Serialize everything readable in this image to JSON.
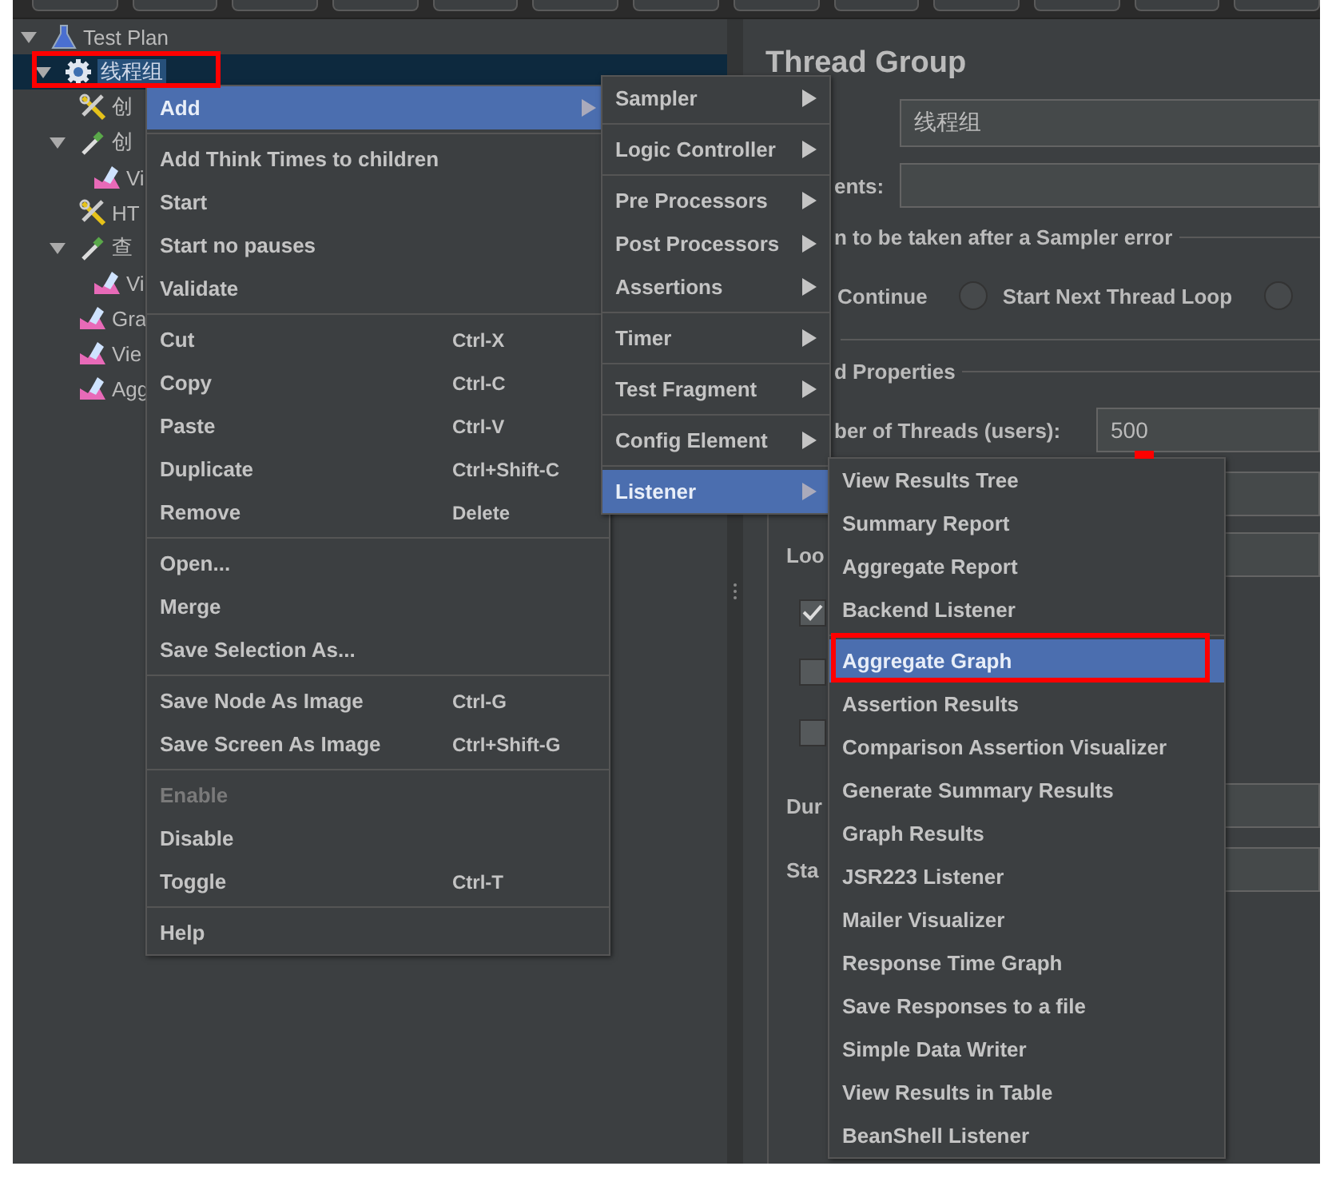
{
  "tree": {
    "items": [
      {
        "label": "Test Plan",
        "kind": "flask",
        "expanded": true,
        "selected": false,
        "children": [
          {
            "label": "线程组",
            "kind": "gear",
            "expanded": true,
            "selected": true,
            "children": [
              {
                "label": "创",
                "kind": "tools",
                "selected": false
              },
              {
                "label": "创",
                "kind": "dropper",
                "expanded": true,
                "selected": false,
                "children": [
                  {
                    "label": "Vi",
                    "kind": "chart",
                    "selected": false
                  }
                ]
              },
              {
                "label": "HT",
                "kind": "tools",
                "selected": false
              },
              {
                "label": "查",
                "kind": "dropper",
                "expanded": true,
                "selected": false,
                "children": [
                  {
                    "label": "Vi",
                    "kind": "chart",
                    "selected": false
                  }
                ]
              },
              {
                "label": "Gra",
                "kind": "chart",
                "selected": false
              },
              {
                "label": "Vie",
                "kind": "chart",
                "selected": false
              },
              {
                "label": "Agg",
                "kind": "chart",
                "selected": false
              }
            ]
          }
        ]
      }
    ]
  },
  "thread_group": {
    "title": "Thread Group",
    "name_value": "线程组",
    "comments_label": "ents:",
    "error_section": "n to be taken after a Sampler error",
    "error_actions": [
      {
        "kind": "label",
        "label": "Continue"
      },
      {
        "kind": "radio",
        "label": "Start Next Thread Loop",
        "selected": false
      },
      {
        "kind": "radio",
        "selected": false
      }
    ],
    "properties_section": "d Properties",
    "threads_label": "ber of Threads (users):",
    "threads_value": "500",
    "loop_label": "Loo",
    "checkboxes": [
      {
        "checked": true
      },
      {
        "checked": false
      },
      {
        "checked": false
      }
    ],
    "duration_label": "Dur",
    "startup_label": "Sta"
  },
  "context_menu": {
    "groups": [
      {
        "items": [
          {
            "label": "Add",
            "has_submenu": true,
            "selected": true,
            "disabled": false
          }
        ]
      },
      {
        "items": [
          {
            "label": "Add Think Times to children",
            "has_submenu": false,
            "selected": false,
            "disabled": false
          },
          {
            "label": "Start",
            "has_submenu": false,
            "selected": false,
            "disabled": false
          },
          {
            "label": "Start no pauses",
            "has_submenu": false,
            "selected": false,
            "disabled": false
          },
          {
            "label": "Validate",
            "has_submenu": false,
            "selected": false,
            "disabled": false
          }
        ]
      },
      {
        "items": [
          {
            "label": "Cut",
            "shortcut": "Ctrl-X",
            "has_submenu": false,
            "selected": false,
            "disabled": false
          },
          {
            "label": "Copy",
            "shortcut": "Ctrl-C",
            "has_submenu": false,
            "selected": false,
            "disabled": false
          },
          {
            "label": "Paste",
            "shortcut": "Ctrl-V",
            "has_submenu": false,
            "selected": false,
            "disabled": false
          },
          {
            "label": "Duplicate",
            "shortcut": "Ctrl+Shift-C",
            "has_submenu": false,
            "selected": false,
            "disabled": false
          },
          {
            "label": "Remove",
            "shortcut": "Delete",
            "has_submenu": false,
            "selected": false,
            "disabled": false
          }
        ]
      },
      {
        "items": [
          {
            "label": "Open...",
            "has_submenu": false,
            "selected": false,
            "disabled": false
          },
          {
            "label": "Merge",
            "has_submenu": false,
            "selected": false,
            "disabled": false
          },
          {
            "label": "Save Selection As...",
            "has_submenu": false,
            "selected": false,
            "disabled": false
          }
        ]
      },
      {
        "items": [
          {
            "label": "Save Node As Image",
            "shortcut": "Ctrl-G",
            "has_submenu": false,
            "selected": false,
            "disabled": false
          },
          {
            "label": "Save Screen As Image",
            "shortcut": "Ctrl+Shift-G",
            "has_submenu": false,
            "selected": false,
            "disabled": false
          }
        ]
      },
      {
        "items": [
          {
            "label": "Enable",
            "has_submenu": false,
            "selected": false,
            "disabled": true
          },
          {
            "label": "Disable",
            "has_submenu": false,
            "selected": false,
            "disabled": false
          },
          {
            "label": "Toggle",
            "shortcut": "Ctrl-T",
            "has_submenu": false,
            "selected": false,
            "disabled": false
          }
        ]
      },
      {
        "items": [
          {
            "label": "Help",
            "has_submenu": false,
            "selected": false,
            "disabled": false
          }
        ]
      }
    ]
  },
  "add_submenu": {
    "groups": [
      {
        "items": [
          {
            "label": "Sampler",
            "has_submenu": true,
            "selected": false,
            "disabled": false
          }
        ]
      },
      {
        "items": [
          {
            "label": "Logic Controller",
            "has_submenu": true,
            "selected": false,
            "disabled": false
          }
        ]
      },
      {
        "items": [
          {
            "label": "Pre Processors",
            "has_submenu": true,
            "selected": false,
            "disabled": false
          },
          {
            "label": "Post Processors",
            "has_submenu": true,
            "selected": false,
            "disabled": false
          },
          {
            "label": "Assertions",
            "has_submenu": true,
            "selected": false,
            "disabled": false
          }
        ]
      },
      {
        "items": [
          {
            "label": "Timer",
            "has_submenu": true,
            "selected": false,
            "disabled": false
          }
        ]
      },
      {
        "items": [
          {
            "label": "Test Fragment",
            "has_submenu": true,
            "selected": false,
            "disabled": false
          }
        ]
      },
      {
        "items": [
          {
            "label": "Config Element",
            "has_submenu": true,
            "selected": false,
            "disabled": false
          }
        ]
      },
      {
        "items": [
          {
            "label": "Listener",
            "has_submenu": true,
            "selected": true,
            "disabled": false
          }
        ]
      }
    ]
  },
  "listener_submenu": {
    "groups": [
      {
        "items": [
          {
            "label": "View Results Tree",
            "has_submenu": false,
            "selected": false,
            "disabled": false
          },
          {
            "label": "Summary Report",
            "has_submenu": false,
            "selected": false,
            "disabled": false
          },
          {
            "label": "Aggregate Report",
            "has_submenu": false,
            "selected": false,
            "disabled": false
          },
          {
            "label": "Backend Listener",
            "has_submenu": false,
            "selected": false,
            "disabled": false
          }
        ]
      },
      {
        "items": [
          {
            "label": "Aggregate Graph",
            "has_submenu": false,
            "selected": true,
            "disabled": false
          },
          {
            "label": "Assertion Results",
            "has_submenu": false,
            "selected": false,
            "disabled": false
          },
          {
            "label": "Comparison Assertion Visualizer",
            "has_submenu": false,
            "selected": false,
            "disabled": false
          },
          {
            "label": "Generate Summary Results",
            "has_submenu": false,
            "selected": false,
            "disabled": false
          },
          {
            "label": "Graph Results",
            "has_submenu": false,
            "selected": false,
            "disabled": false
          },
          {
            "label": "JSR223 Listener",
            "has_submenu": false,
            "selected": false,
            "disabled": false
          },
          {
            "label": "Mailer Visualizer",
            "has_submenu": false,
            "selected": false,
            "disabled": false
          },
          {
            "label": "Response Time Graph",
            "has_submenu": false,
            "selected": false,
            "disabled": false
          },
          {
            "label": "Save Responses to a file",
            "has_submenu": false,
            "selected": false,
            "disabled": false
          },
          {
            "label": "Simple Data Writer",
            "has_submenu": false,
            "selected": false,
            "disabled": false
          },
          {
            "label": "View Results in Table",
            "has_submenu": false,
            "selected": false,
            "disabled": false
          },
          {
            "label": "BeanShell Listener",
            "has_submenu": false,
            "selected": false,
            "disabled": false
          }
        ]
      }
    ]
  },
  "highlight_marks": [
    {
      "kind": "frame"
    },
    {
      "kind": "frame"
    },
    {
      "kind": "dash"
    }
  ]
}
